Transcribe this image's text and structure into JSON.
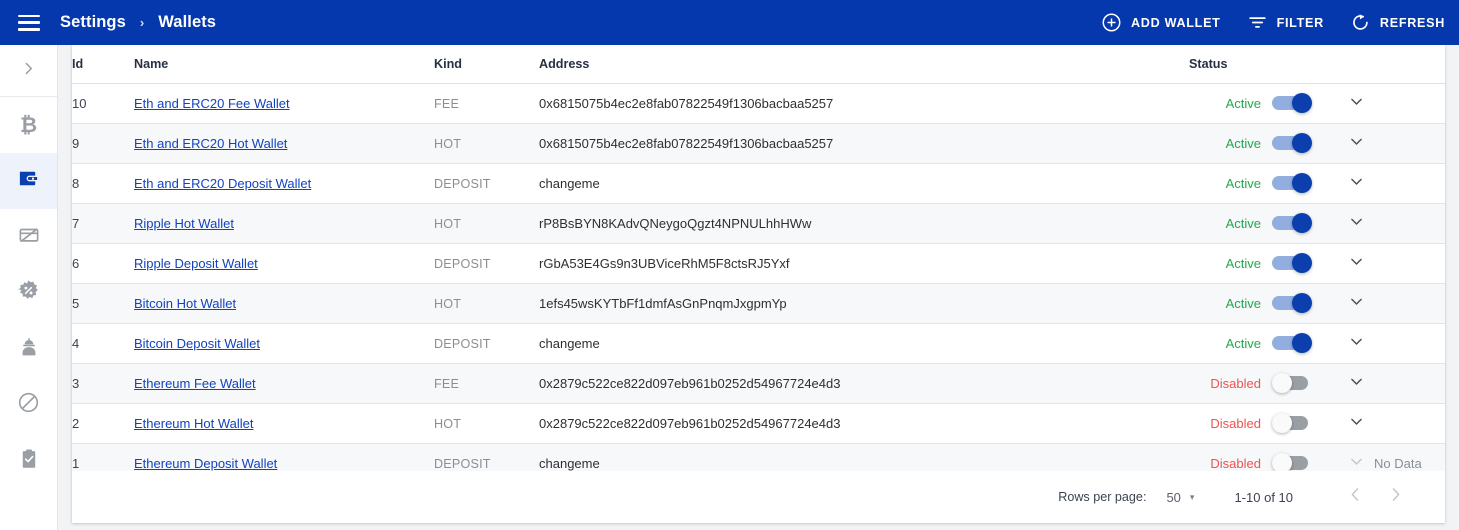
{
  "appbar": {
    "menu_icon": "hamburger-menu-icon",
    "breadcrumb": {
      "parent": "Settings",
      "separator": "›",
      "current": "Wallets"
    },
    "actions": [
      {
        "label": "ADD WALLET",
        "icon": "plus-circle-icon"
      },
      {
        "label": "FILTER",
        "icon": "filter-icon"
      },
      {
        "label": "REFRESH",
        "icon": "refresh-icon"
      }
    ],
    "bg_color": "#0537ad"
  },
  "sidebar": {
    "items": [
      {
        "icon": "chevron-right-icon",
        "name": "expand-sidebar",
        "active": false
      },
      {
        "icon": "bitcoin-icon",
        "name": "sidebar-item-bitcoin",
        "active": false
      },
      {
        "icon": "wallet-icon",
        "name": "sidebar-item-wallets",
        "active": true
      },
      {
        "icon": "card-off-icon",
        "name": "sidebar-item-cards",
        "active": false
      },
      {
        "icon": "percent-badge-icon",
        "name": "sidebar-item-fees",
        "active": false
      },
      {
        "icon": "engineer-icon",
        "name": "sidebar-item-operators",
        "active": false
      },
      {
        "icon": "ban-icon",
        "name": "sidebar-item-blocklist",
        "active": false
      },
      {
        "icon": "clipboard-check-icon",
        "name": "sidebar-item-tasks",
        "active": false
      }
    ],
    "active_bg": "#eef2fb",
    "active_color": "#0b3fae"
  },
  "table": {
    "columns": [
      "Id",
      "Name",
      "Kind",
      "Address",
      "Status"
    ],
    "rows": [
      {
        "id": "10",
        "name": "Eth and ERC20 Fee Wallet",
        "kind": "FEE",
        "address": "0x6815075b4ec2e8fab07822549f1306bacbaa5257",
        "status": "Active",
        "enabled": true,
        "no_data": false
      },
      {
        "id": "9",
        "name": "Eth and ERC20 Hot Wallet",
        "kind": "HOT",
        "address": "0x6815075b4ec2e8fab07822549f1306bacbaa5257",
        "status": "Active",
        "enabled": true,
        "no_data": false
      },
      {
        "id": "8",
        "name": "Eth and ERC20 Deposit Wallet",
        "kind": "DEPOSIT",
        "address": "changeme",
        "status": "Active",
        "enabled": true,
        "no_data": false
      },
      {
        "id": "7",
        "name": "Ripple Hot Wallet",
        "kind": "HOT",
        "address": "rP8BsBYN8KAdvQNeygoQgzt4NPNULhhHWw",
        "status": "Active",
        "enabled": true,
        "no_data": false
      },
      {
        "id": "6",
        "name": "Ripple Deposit Wallet",
        "kind": "DEPOSIT",
        "address": "rGbA53E4Gs9n3UBViceRhM5F8ctsRJ5Yxf",
        "status": "Active",
        "enabled": true,
        "no_data": false
      },
      {
        "id": "5",
        "name": "Bitcoin Hot Wallet",
        "kind": "HOT",
        "address": "1efs45wsKYTbFf1dmfAsGnPnqmJxgpmYp",
        "status": "Active",
        "enabled": true,
        "no_data": false
      },
      {
        "id": "4",
        "name": "Bitcoin Deposit Wallet",
        "kind": "DEPOSIT",
        "address": "changeme",
        "status": "Active",
        "enabled": true,
        "no_data": false
      },
      {
        "id": "3",
        "name": "Ethereum Fee Wallet",
        "kind": "FEE",
        "address": "0x2879c522ce822d097eb961b0252d54967724e4d3",
        "status": "Disabled",
        "enabled": false,
        "no_data": false
      },
      {
        "id": "2",
        "name": "Ethereum Hot Wallet",
        "kind": "HOT",
        "address": "0x2879c522ce822d097eb961b0252d54967724e4d3",
        "status": "Disabled",
        "enabled": false,
        "no_data": false
      },
      {
        "id": "1",
        "name": "Ethereum Deposit Wallet",
        "kind": "DEPOSIT",
        "address": "changeme",
        "status": "Disabled",
        "enabled": false,
        "no_data": true
      }
    ],
    "no_data_label": "No Data",
    "status_active_color": "#1faa4b",
    "status_disabled_color": "#ef5350",
    "toggle_on_color": "#0b3fae",
    "toggle_off_color": "#9a9ea5"
  },
  "footer": {
    "rows_per_page_label": "Rows per page:",
    "rows_per_page_value": "50",
    "range_label": "1-10 of 10",
    "prev_icon": "chevron-left-icon",
    "next_icon": "chevron-right-icon"
  }
}
